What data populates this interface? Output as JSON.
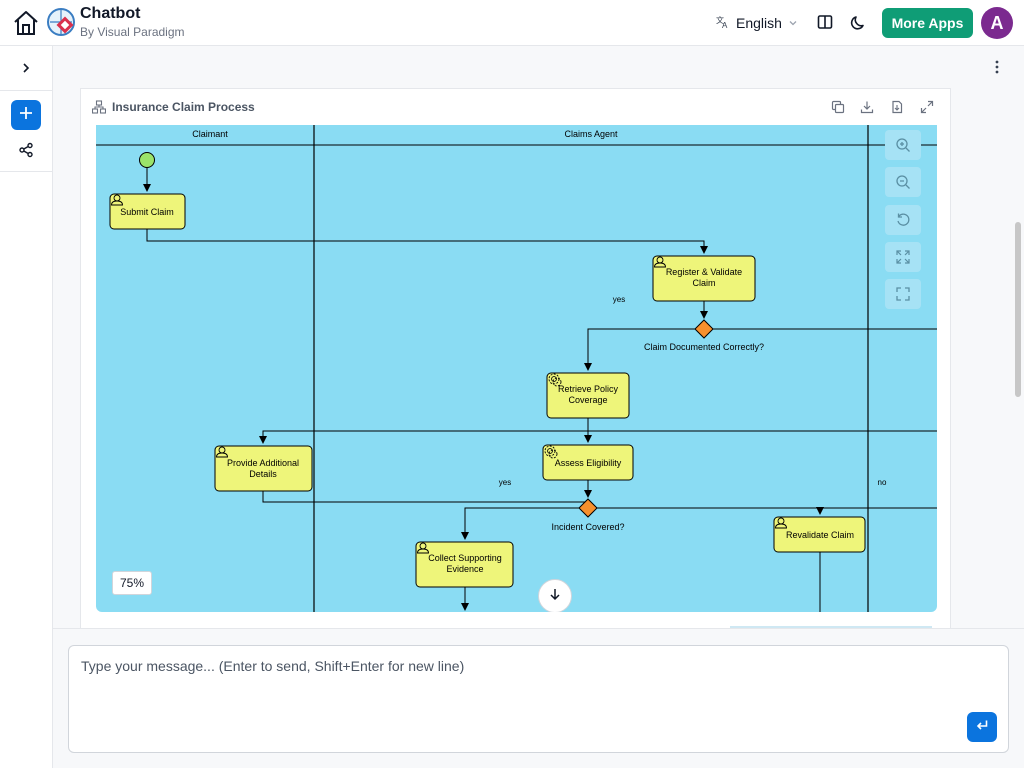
{
  "header": {
    "app_title": "Chatbot",
    "app_subtitle": "By Visual Paradigm",
    "language": "English",
    "more_apps_label": "More Apps",
    "avatar_initial": "A",
    "accent_color": "#0f9d76",
    "avatar_color": "#7b2a8f"
  },
  "diagram": {
    "title": "Insurance Claim Process",
    "zoom_level": "75%",
    "lanes": [
      "Claimant",
      "Claims Agent"
    ],
    "tasks": {
      "submit_claim": "Submit Claim",
      "register_validate_1": "Register & Validate",
      "register_validate_2": "Claim",
      "retrieve_policy_1": "Retrieve Policy",
      "retrieve_policy_2": "Coverage",
      "assess_eligibility": "Assess Eligibility",
      "provide_details_1": "Provide Additional",
      "provide_details_2": "Details",
      "collect_evidence_1": "Collect Supporting",
      "collect_evidence_2": "Evidence",
      "revalidate_claim": "Revalidate Claim"
    },
    "gateways": {
      "claim_documented": "Claim Documented Correctly?",
      "incident_covered": "Incident Covered?"
    },
    "flow_labels": {
      "yes_1": "yes",
      "yes_2": "yes",
      "no_1": "no"
    },
    "canvas_color": "#8adcf3",
    "task_color": "#eef57a",
    "gateway_color": "#f7902d"
  },
  "composer": {
    "placeholder": "Type your message... (Enter to send, Shift+Enter for new line)"
  }
}
